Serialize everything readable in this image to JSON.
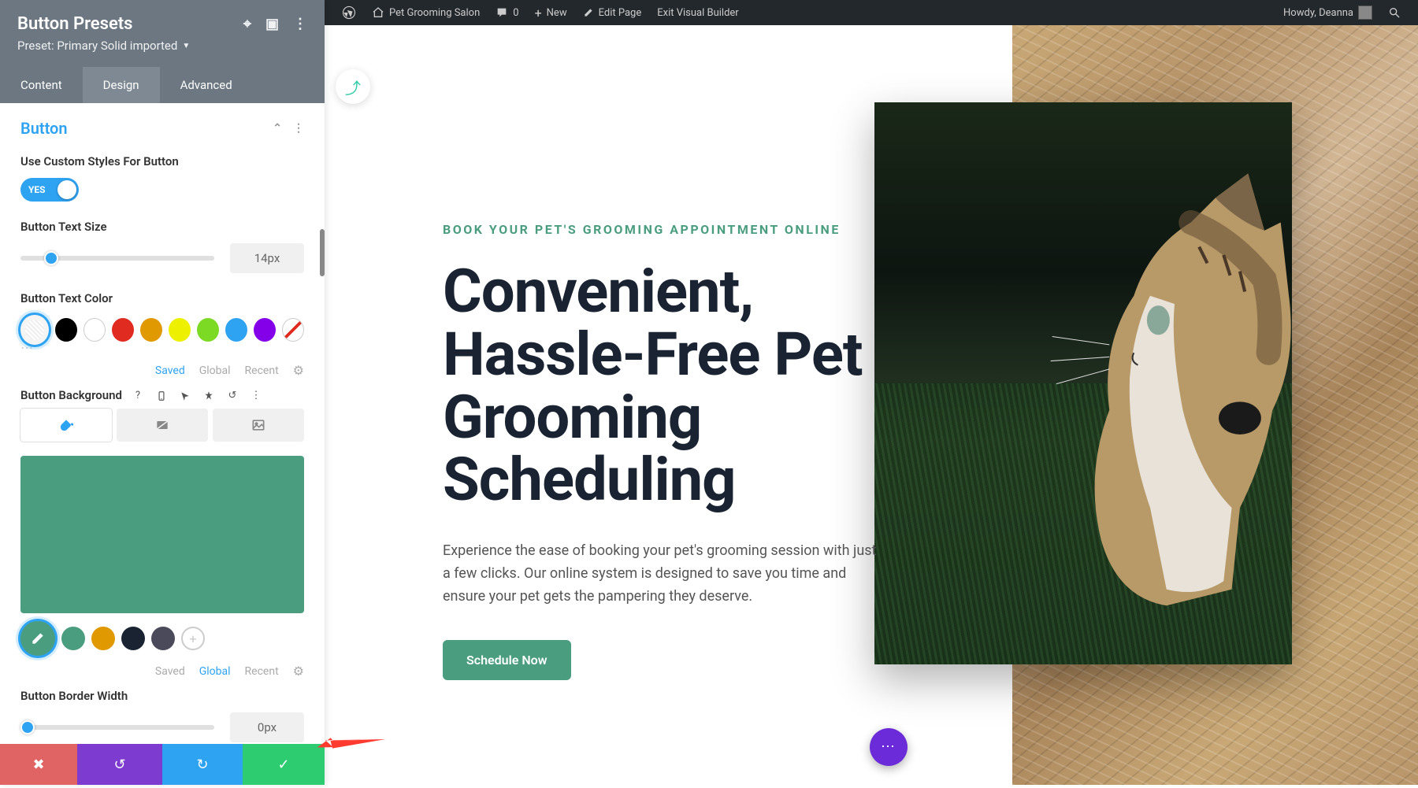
{
  "panel": {
    "title": "Button Presets",
    "preset_label": "Preset: Primary Solid imported",
    "tabs": [
      "Content",
      "Design",
      "Advanced"
    ],
    "active_tab": 1,
    "section": "Button",
    "custom_styles_label": "Use Custom Styles For Button",
    "toggle_text": "YES",
    "text_size_label": "Button Text Size",
    "text_size_value": "14px",
    "text_color_label": "Button Text Color",
    "bg_label": "Button Background",
    "border_width_label": "Button Border Width",
    "border_width_value": "0px",
    "color_tabs": {
      "saved": "Saved",
      "global": "Global",
      "recent": "Recent"
    },
    "bg_preview_color": "#4a9d7f",
    "global_colors": [
      "#4a9d7f",
      "#e09900",
      "#1a2332",
      "#4a4a5a"
    ]
  },
  "wpbar": {
    "site": "Pet Grooming Salon",
    "comments": "0",
    "new": "New",
    "edit": "Edit Page",
    "exit": "Exit Visual Builder",
    "howdy": "Howdy, Deanna"
  },
  "preview": {
    "kicker": "BOOK YOUR PET'S GROOMING APPOINTMENT ONLINE",
    "headline": "Convenient, Hassle-Free Pet Grooming Scheduling",
    "body": "Experience the ease of booking your pet's grooming session with just a few clicks. Our online system is designed to save you time and ensure your pet gets the pampering they deserve.",
    "cta": "Schedule Now"
  }
}
